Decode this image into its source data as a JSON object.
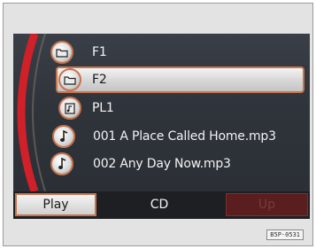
{
  "list": {
    "items": [
      {
        "label": "F1",
        "icon": "folder-icon",
        "selected": false
      },
      {
        "label": "F2",
        "icon": "folder-icon",
        "selected": true
      },
      {
        "label": "PL1",
        "icon": "playlist-icon",
        "selected": false
      },
      {
        "label": "001 A Place Called Home.mp3",
        "icon": "music-note-icon",
        "selected": false
      },
      {
        "label": "002 Any Day Now.mp3",
        "icon": "music-note-icon",
        "selected": false
      }
    ]
  },
  "bottom_bar": {
    "play_label": "Play",
    "source_label": "CD",
    "up_label": "Up",
    "up_enabled": false
  },
  "figure_code": "B5P-0531",
  "colors": {
    "accent": "#c6744e",
    "scroll_arc": "#d0202a",
    "screen_bg": "#2f343b"
  }
}
